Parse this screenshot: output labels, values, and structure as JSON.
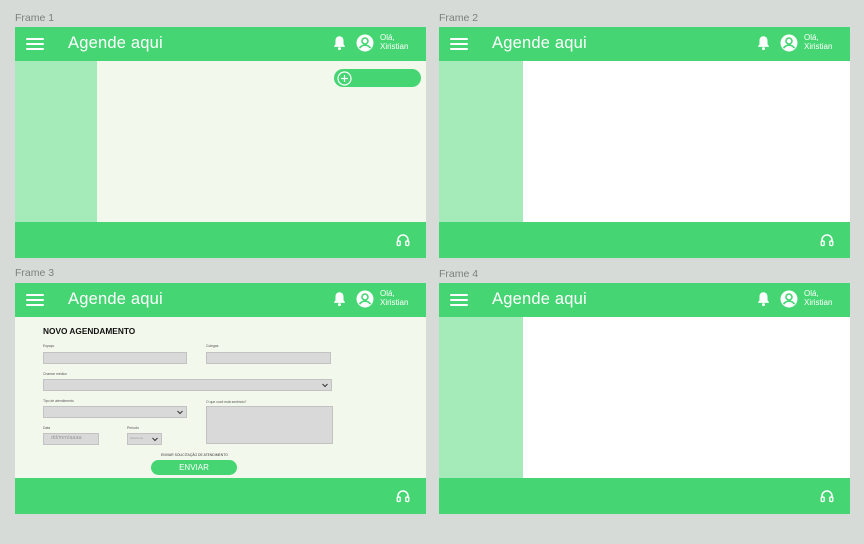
{
  "app": {
    "title": "Agende aqui",
    "greeting_line1": "Olá,",
    "greeting_line2": "Xiristian"
  },
  "frames": [
    {
      "label": "Frame 1"
    },
    {
      "label": "Frame 2"
    },
    {
      "label": "Frame 3"
    },
    {
      "label": "Frame 4"
    }
  ],
  "icons": {
    "menu": "hamburger-icon",
    "notifications": "bell-icon",
    "profile": "user-circle-icon",
    "support": "headset-icon",
    "add": "plus-circle-icon",
    "dropdown": "chevron-down-icon"
  },
  "form": {
    "title": "NOVO AGENDAMENTO",
    "field_1_label": "Espaço",
    "field_2_label": "Colegas",
    "field_3_label": "Chamar médico",
    "field_4_label": "Tipo de atendimento",
    "field_5_label": "O que você está sentindo?",
    "date_label": "Data",
    "date_placeholder": "dd/mm/aaaa",
    "period_label": "Período",
    "period_value": "Selecione",
    "agreement": "ENVIAR SOLICITAÇÃO DE ATENDIMENTO",
    "submit_label": "ENVIAR"
  },
  "colors": {
    "primary": "#45d673",
    "sidebar": "#a4ebb9",
    "content_cream": "#f3f8ec",
    "canvas": "#d7dbd8"
  }
}
